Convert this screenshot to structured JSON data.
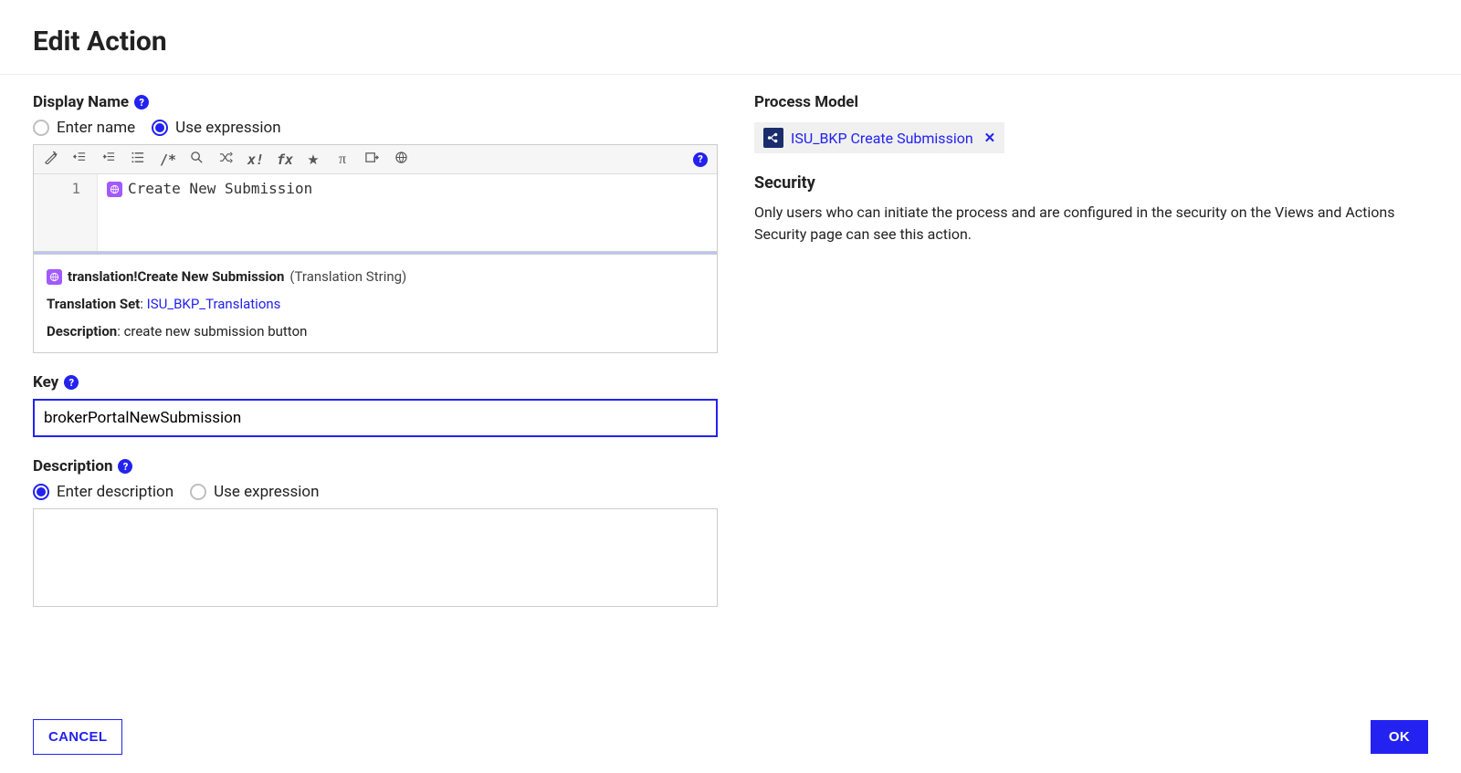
{
  "page": {
    "title": "Edit Action"
  },
  "displayName": {
    "label": "Display Name",
    "options": {
      "enterName": "Enter name",
      "useExpression": "Use expression"
    },
    "selected": "useExpression",
    "editor": {
      "lineNumber": "1",
      "expression": "Create New Submission"
    },
    "info": {
      "expr": "translation!Create New Submission",
      "type": "(Translation String)",
      "translationSetLabel": "Translation Set",
      "translationSetValue": "ISU_BKP_Translations",
      "descriptionLabel": "Description",
      "descriptionValue": "create new submission button"
    }
  },
  "key": {
    "label": "Key",
    "value": "brokerPortalNewSubmission"
  },
  "description": {
    "label": "Description",
    "options": {
      "enterDescription": "Enter description",
      "useExpression": "Use expression"
    },
    "selected": "enterDescription",
    "value": ""
  },
  "processModel": {
    "label": "Process Model",
    "chip": "ISU_BKP Create Submission"
  },
  "security": {
    "label": "Security",
    "text": "Only users who can initiate the process and are configured in the security on the Views and Actions Security page can see this action."
  },
  "footer": {
    "cancel": "CANCEL",
    "ok": "OK"
  },
  "icons": {
    "wand": "✧",
    "outdent": "≡",
    "indent": "≡",
    "list": "≡",
    "comment": "/*",
    "search": "🔍",
    "shuffle": "⇄",
    "xmark": "x!",
    "fx": "fx",
    "star": "★",
    "pi": "π",
    "export": "⇲",
    "globe": "⊕"
  }
}
